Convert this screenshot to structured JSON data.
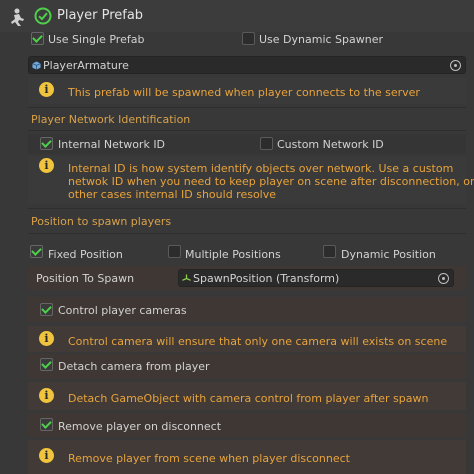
{
  "header": {
    "title": "Player Prefab"
  },
  "prefab": {
    "use_single_label": "Use Single Prefab",
    "use_dynamic_label": "Use Dynamic Spawner",
    "object_name": "PlayerArmature",
    "help": "This prefab will be spawned when player connects to the server"
  },
  "network": {
    "section_title": "Player Network Identification",
    "internal_label": "Internal Network ID",
    "custom_label": "Custom Network ID",
    "help_line1": "Internal ID is how system identify objects over network. Use a custom",
    "help_line2": "netwok ID when you need to keep player on scene after disconnection, on all",
    "help_line3": "other cases internal ID should resolve"
  },
  "spawn": {
    "section_title": "Position to spawn players",
    "fixed_label": "Fixed Position",
    "multiple_label": "Multiple Positions",
    "dynamic_label": "Dynamic Position",
    "position_label": "Position To Spawn",
    "position_value": "SpawnPosition (Transform)"
  },
  "camera": {
    "control_label": "Control player cameras",
    "control_help": "Control camera will ensure that only one camera will exists on scene",
    "detach_label": "Detach camera from player",
    "detach_help": "Detach GameObject with camera control from player after spawn",
    "remove_label": "Remove player on disconnect",
    "remove_help": "Remove player from scene when player disconnect"
  },
  "colors": {
    "accent": "#e8a33c",
    "check": "#4fd04a",
    "info": "#f0c43c"
  }
}
